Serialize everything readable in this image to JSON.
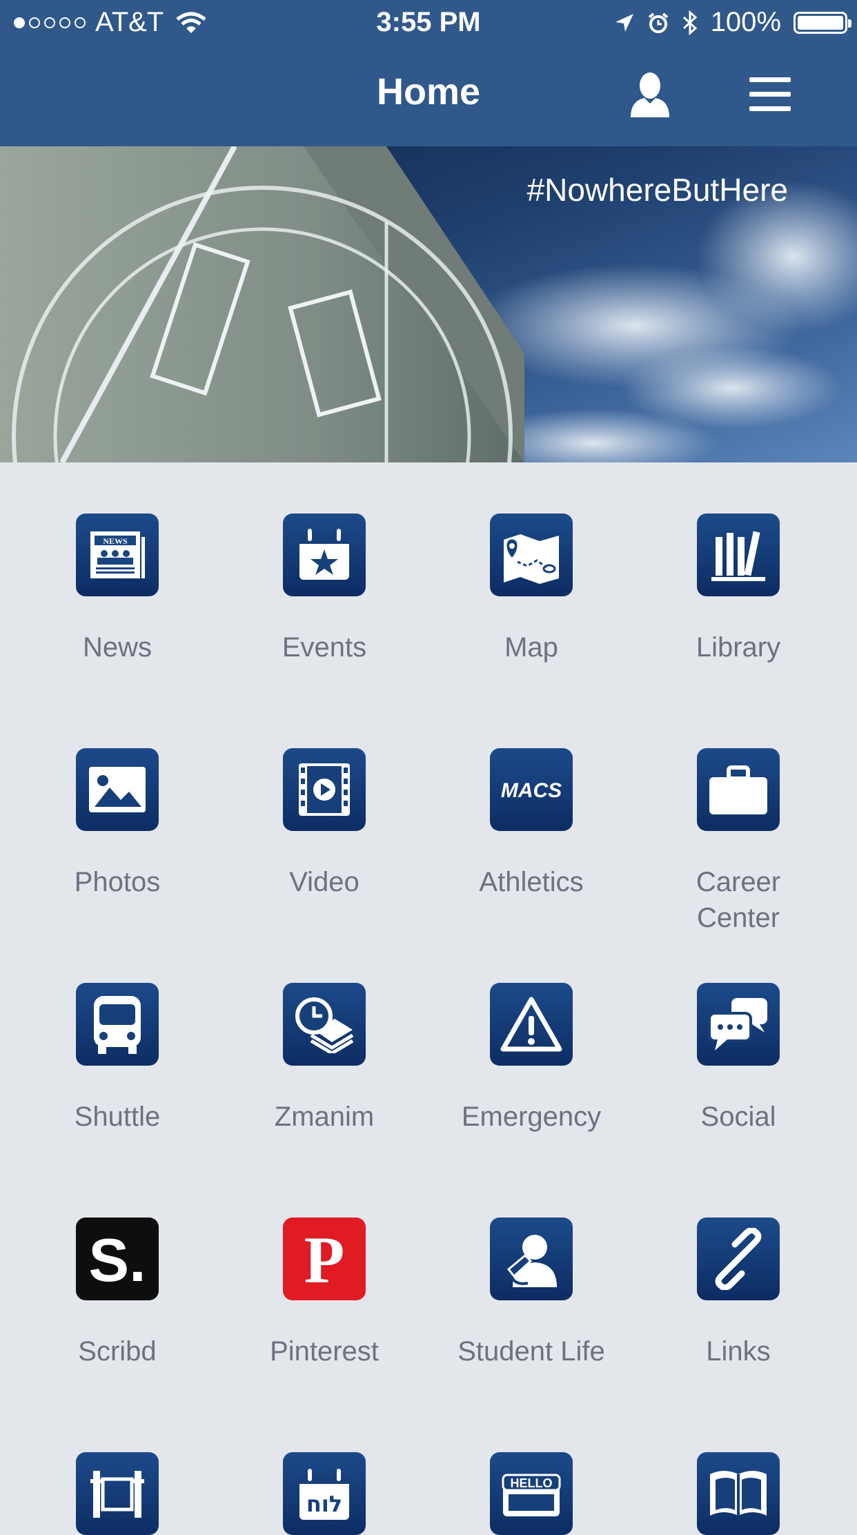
{
  "status": {
    "carrier": "AT&T",
    "time": "3:55 PM",
    "battery": "100%"
  },
  "nav": {
    "title": "Home"
  },
  "banner": {
    "hashtag": "#NowhereButHere"
  },
  "tiles": [
    {
      "label": "News",
      "icon": "news-icon"
    },
    {
      "label": "Events",
      "icon": "calendar-star-icon"
    },
    {
      "label": "Map",
      "icon": "map-icon"
    },
    {
      "label": "Library",
      "icon": "books-icon"
    },
    {
      "label": "Photos",
      "icon": "photo-icon"
    },
    {
      "label": "Video",
      "icon": "video-icon"
    },
    {
      "label": "Athletics",
      "icon": "macs-icon",
      "icon_text": "MACS"
    },
    {
      "label": "Career Center",
      "icon": "briefcase-icon"
    },
    {
      "label": "Shuttle",
      "icon": "bus-icon"
    },
    {
      "label": "Zmanim",
      "icon": "clock-book-icon"
    },
    {
      "label": "Emergency",
      "icon": "warning-icon"
    },
    {
      "label": "Social",
      "icon": "chat-bubbles-icon"
    },
    {
      "label": "Scribd",
      "icon": "scribd-icon",
      "icon_text": "S."
    },
    {
      "label": "Pinterest",
      "icon": "pinterest-icon",
      "icon_text": "P"
    },
    {
      "label": "Student Life",
      "icon": "student-icon"
    },
    {
      "label": "Links",
      "icon": "link-icon"
    },
    {
      "label": "",
      "icon": "scroll-icon"
    },
    {
      "label": "",
      "icon": "hebrew-calendar-icon",
      "icon_text": "לוח"
    },
    {
      "label": "",
      "icon": "hello-tag-icon",
      "icon_text": "HELLO"
    },
    {
      "label": "",
      "icon": "open-book-icon"
    }
  ],
  "colors": {
    "bar": "#30588a",
    "icon_blue": "#123a73",
    "background": "#e3e6eb"
  }
}
